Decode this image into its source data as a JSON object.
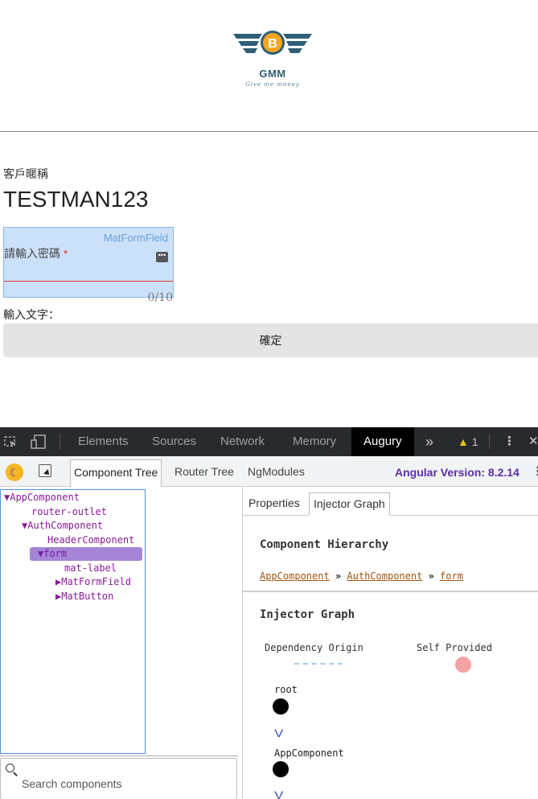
{
  "app": {
    "logo": {
      "brand": "GMM",
      "tagline": "Give me money",
      "coin_symbol": "B",
      "color": "#2f5f75",
      "coin_color": "#f5a623"
    },
    "customer_label": "客戶暱稱",
    "customer_name": "TESTMAN123",
    "password_field": {
      "debug_tag": "MatFormField",
      "placeholder": "請輸入密碼",
      "required_mark": "*",
      "counter": "0/10"
    },
    "input_hint": "輸入文字：",
    "confirm_label": "確定"
  },
  "devtools": {
    "tabs": [
      "Elements",
      "Sources",
      "Network",
      "Memory",
      "Augury"
    ],
    "active_tab": "Augury",
    "overflow": "»",
    "warning_count": "1",
    "augury": {
      "tabs": [
        "Component Tree",
        "Router Tree",
        "NgModules"
      ],
      "active_tab": "Component Tree",
      "angular_version": "Angular Version: 8.2.14",
      "tree": [
        {
          "label": "▼AppComponent",
          "depth": 0,
          "selected": false
        },
        {
          "label": "router-outlet",
          "depth": 1,
          "selected": false
        },
        {
          "label": "▼AuthComponent",
          "depth": 1,
          "selected": false
        },
        {
          "label": "HeaderComponent",
          "depth": 2,
          "selected": false
        },
        {
          "label": "▼form",
          "depth": 2,
          "selected": true
        },
        {
          "label": "mat-label",
          "depth": 3,
          "selected": false
        },
        {
          "label": "▶MatFormField",
          "depth": 3,
          "selected": false
        },
        {
          "label": "▶MatButton",
          "depth": 3,
          "selected": false
        }
      ],
      "search_placeholder": "Search components",
      "detail_tabs": [
        "Properties",
        "Injector Graph"
      ],
      "detail_active": "Injector Graph",
      "hierarchy_title": "Component Hierarchy",
      "breadcrumbs": [
        "AppComponent",
        "AuthComponent",
        "form"
      ],
      "breadcrumb_sep": "»",
      "injector_title": "Injector Graph",
      "legend": {
        "dependency_origin": "Dependency Origin",
        "self_provided": "Self Provided"
      },
      "graph_nodes": [
        "root",
        "AppComponent"
      ],
      "chevron": "V"
    }
  }
}
